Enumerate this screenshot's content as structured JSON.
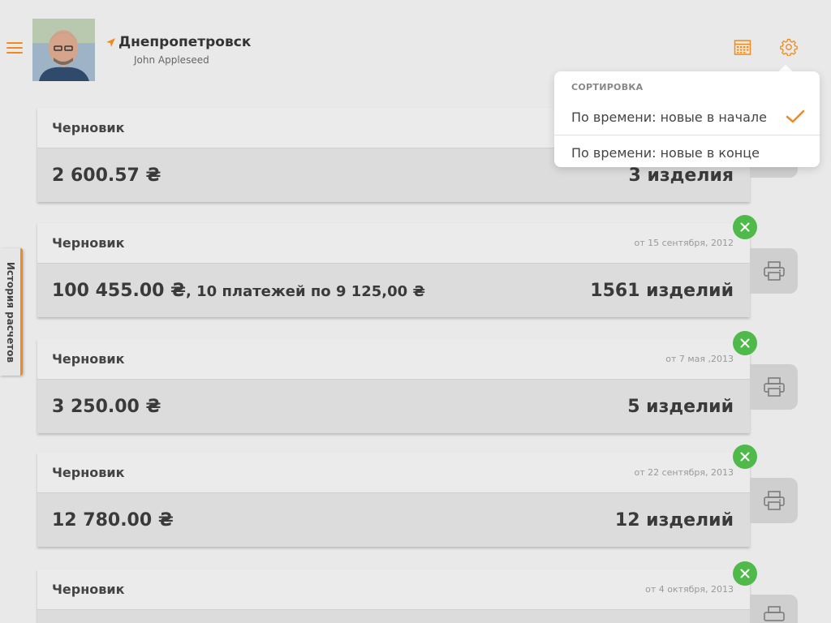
{
  "header": {
    "city": "Днепропетровск",
    "user_name": "John Appleseed"
  },
  "icons": {
    "menu": "hamburger-menu-icon",
    "location": "location-arrow-icon",
    "calendar": "calendar-icon",
    "settings": "gear-icon",
    "delete": "close-icon",
    "print": "printer-icon"
  },
  "colors": {
    "accent": "#f08a1c",
    "delete": "#4fb94a",
    "background": "#e9e9e9"
  },
  "side_tab": {
    "label": "История расчетов"
  },
  "sort_popover": {
    "header": "Сортировка",
    "options": [
      {
        "label": "По времени: новые в начале",
        "selected": true
      },
      {
        "label": "По времени: новые в конце",
        "selected": false
      }
    ]
  },
  "cards": [
    {
      "title": "Черновик",
      "date": "",
      "amount": "2 600.57 ₴",
      "payments": "",
      "items": "3 изделия"
    },
    {
      "title": "Черновик",
      "date": "от 15 сентября, 2012",
      "amount": "100 455.00 ₴",
      "payments": ", 10 платежей по 9 125,00 ₴",
      "items": "1561 изделий"
    },
    {
      "title": "Черновик",
      "date": "от 7 мая ,2013",
      "amount": "3 250.00 ₴",
      "payments": "",
      "items": "5 изделий"
    },
    {
      "title": "Черновик",
      "date": "от 22 сентября, 2013",
      "amount": "12 780.00 ₴",
      "payments": "",
      "items": "12 изделий"
    },
    {
      "title": "Черновик",
      "date": "от 4 октября, 2013",
      "amount": "",
      "payments": "",
      "items": ""
    }
  ]
}
